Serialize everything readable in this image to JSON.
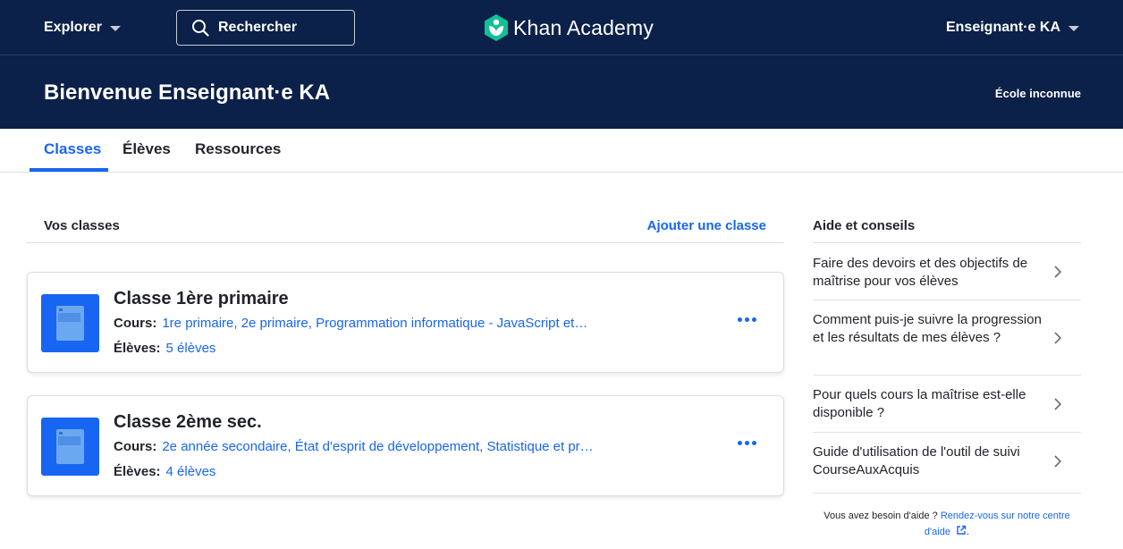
{
  "nav": {
    "explore_label": "Explorer",
    "search_label": "Rechercher",
    "logo_text": "Khan Academy",
    "user_label": "Enseignant·e KA"
  },
  "hero": {
    "welcome": "Bienvenue Enseignant·e KA",
    "school": "École inconnue"
  },
  "tabs": [
    {
      "label": "Classes",
      "active": true
    },
    {
      "label": "Élèves",
      "active": false
    },
    {
      "label": "Ressources",
      "active": false
    }
  ],
  "classes": {
    "heading": "Vos classes",
    "add_label": "Ajouter une classe",
    "courses_label": "Cours:",
    "students_label": "Élèves:",
    "items": [
      {
        "name": "Classe 1ère primaire",
        "courses": "1re primaire, 2e primaire, Programmation informatique - JavaScript et…",
        "students": "5 élèves"
      },
      {
        "name": "Classe 2ème sec.",
        "courses": "2e année secondaire, État d'esprit de développement, Statistique et pr…",
        "students": "4 élèves"
      }
    ]
  },
  "help": {
    "heading": "Aide et conseils",
    "items": [
      "Faire des devoirs et des objectifs de maîtrise pour vos élèves",
      "Comment puis-je suivre la progression et les résultats de mes élèves ?",
      "Pour quels cours la maîtrise est-elle disponible ?",
      "Guide d'utilisation de l'outil de suivi CourseAuxAcquis"
    ],
    "footer_text": "Vous avez besoin d'aide ?",
    "footer_link": "Rendez-vous sur notre centre d'aide",
    "footer_end": "."
  },
  "colors": {
    "navy": "#0b2149",
    "accent_blue": "#1865f2",
    "logo_green": "#14bf96"
  }
}
